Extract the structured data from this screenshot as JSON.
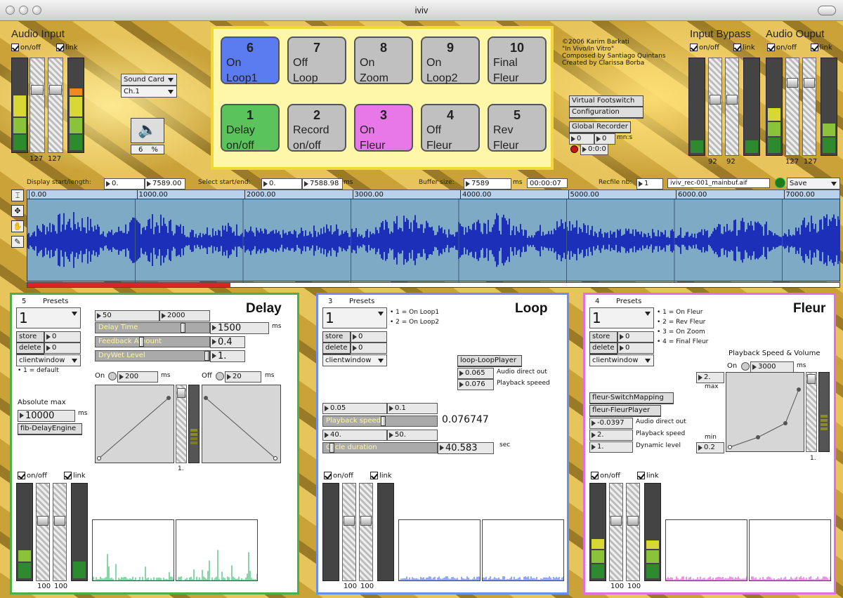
{
  "window": {
    "title": "iviv"
  },
  "audio_input": {
    "title": "Audio Input",
    "onoff": "on/off",
    "link": "link",
    "left_value": "127",
    "right_value": "127"
  },
  "sound_card": {
    "label": "Sound Card",
    "channel": "Ch.1",
    "volume": "6",
    "unit": "%"
  },
  "presets": [
    {
      "num": "6",
      "line1": "On",
      "line2": "Loop1",
      "color": "#5b7cf0"
    },
    {
      "num": "7",
      "line1": "Off",
      "line2": "Loop",
      "color": "#c0c0c0"
    },
    {
      "num": "8",
      "line1": "On",
      "line2": "Zoom",
      "color": "#c0c0c0"
    },
    {
      "num": "9",
      "line1": "On",
      "line2": "Loop2",
      "color": "#c0c0c0"
    },
    {
      "num": "10",
      "line1": "Final",
      "line2": "Fleur",
      "color": "#c0c0c0"
    },
    {
      "num": "1",
      "line1": "Delay",
      "line2": "on/off",
      "color": "#5bc35b"
    },
    {
      "num": "2",
      "line1": "Record",
      "line2": "on/off",
      "color": "#c0c0c0"
    },
    {
      "num": "3",
      "line1": "On",
      "line2": "Fleur",
      "color": "#e877e8"
    },
    {
      "num": "4",
      "line1": "Off",
      "line2": "Fleur",
      "color": "#c0c0c0"
    },
    {
      "num": "5",
      "line1": "Rev",
      "line2": "Fleur",
      "color": "#c0c0c0"
    }
  ],
  "credits": [
    "©2006 Karim Barkati",
    "\"In Vivo/In Vitro\"",
    "Composed by Santiago Quintans",
    "Created by Clarissa Borba"
  ],
  "footswitch": {
    "line1": "Virtual Footswitch",
    "line2": "Configuration",
    "recorder": "Global Recorder",
    "v1": "0",
    "v2": "0",
    "unit": "mn:s",
    "time": "0:0:0"
  },
  "input_bypass": {
    "title": "Input Bypass",
    "onoff": "on/off",
    "link": "link",
    "left_value": "92",
    "right_value": "92"
  },
  "audio_output": {
    "title": "Audio Ouput",
    "onoff": "on/off",
    "link": "link",
    "left_value": "127",
    "right_value": "127"
  },
  "buffer_bar": {
    "display_label": "Display start/length:",
    "display_start": "0.",
    "display_length": "7589.00",
    "select_label": "Select start/end:",
    "select_start": "0.",
    "select_end": "7588.98",
    "select_unit": "ms",
    "buffer_label": "Buffer size:",
    "buffer_size": "7589",
    "buffer_unit": "ms",
    "buffer_time": "00:00:07",
    "recfile_label": "Recfile nb:",
    "recfile_nb": "1",
    "filename": "iviv_rec-001_mainbuf.aif",
    "save": "Save"
  },
  "ruler": [
    "0.00",
    "1000.00",
    "2000.00",
    "3000.00",
    "4000.00",
    "5000.00",
    "6000.00",
    "7000.00"
  ],
  "playback_progress": 0.25,
  "delay": {
    "title": "Delay",
    "preset_num": "5",
    "presets_label": "Presets",
    "preset_value": "1",
    "store": "store",
    "store_v": "0",
    "delete": "delete",
    "delete_v": "0",
    "clientwindow": "clientwindow",
    "default_note": "• 1 = default",
    "min": "50",
    "max": "2000",
    "delay_time_label": "Delay Time",
    "delay_time": "1500",
    "ms": "ms",
    "delay_time_fraction": 0.78,
    "feedback_label": "Feedback Amount",
    "feedback": "0.4",
    "feedback_fraction": 0.4,
    "drywet_label": "DryWet Level",
    "drywet": "1.",
    "drywet_fraction": 1.0,
    "on_label": "On",
    "on_ms": "200",
    "off_label": "Off",
    "off_ms": "20",
    "absmax_label": "Absolute max",
    "absmax": "10000",
    "engine": "fib-DelayEngine",
    "fader_value": "1.",
    "onoff": "on/off",
    "link": "link",
    "left_value": "100",
    "right_value": "100",
    "wave_color": "#5fc88a"
  },
  "loop": {
    "title": "Loop",
    "preset_num": "3",
    "presets_label": "Presets",
    "preset_value": "1",
    "store": "store",
    "store_v": "0",
    "delete": "delete",
    "delete_v": "0",
    "clientwindow": "clientwindow",
    "notes": [
      "• 1 = On Loop1",
      "• 2 = On Loop2"
    ],
    "player": "loop-LoopPlayer",
    "direct_v": "0.065",
    "direct_label": "Audio direct out",
    "speed_v": "0.076",
    "speed_label": "Playback speeed",
    "ps_min": "0.05",
    "ps_max": "0.1",
    "ps_label": "Playback speed",
    "ps_value": "0.076747",
    "ps_fraction": 0.53,
    "cd_min": "40.",
    "cd_max": "50.",
    "cd_label": "Cycle duration",
    "cd_value": "40.583",
    "cd_unit": "sec",
    "cd_fraction": 0.06,
    "onoff": "on/off",
    "link": "link",
    "left_value": "100",
    "right_value": "100",
    "wave_color": "#6a8ef0"
  },
  "fleur": {
    "title": "Fleur",
    "preset_num": "4",
    "presets_label": "Presets",
    "preset_value": "1",
    "store": "store",
    "store_v": "0",
    "delete": "delete",
    "delete_v": "0",
    "clientwindow": "clientwindow",
    "notes": [
      "• 1 = On Fleur",
      "• 2 = Rev Fleur",
      "• 3 = On Zoom",
      "• 4 = Final Fleur"
    ],
    "speed_title": "Playback Speed & Volume",
    "on_label": "On",
    "on_ms": "3000",
    "ms": "ms",
    "max_v": "2.",
    "max_label": "max",
    "min_label": "min",
    "min_v": "0.2",
    "switch": "fleur-SwitchMapping",
    "player": "fleur-FleurPlayer",
    "direct_v": "-0.0397",
    "direct_label": "Audio direct out",
    "speed_v": "2.",
    "speed_label": "Playback speed",
    "dyn_v": "1.",
    "dyn_label": "Dynamic level",
    "fader_value": "1.",
    "onoff": "on/off",
    "link": "link",
    "left_value": "100",
    "right_value": "100",
    "wave_color": "#e070e0"
  }
}
